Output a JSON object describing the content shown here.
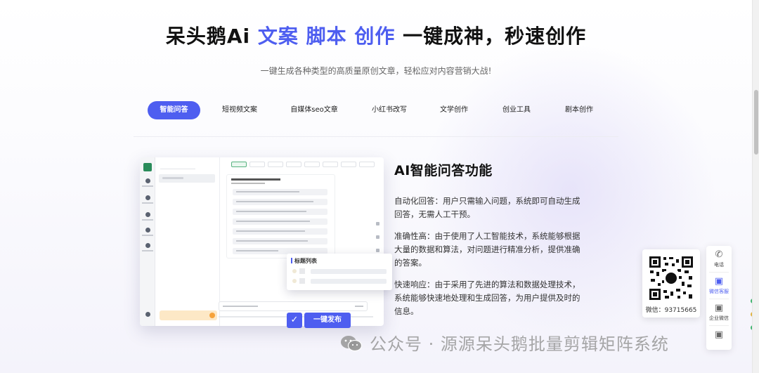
{
  "hero": {
    "title_plain_1": "呆头鹅Ai ",
    "title_accent": "文案 脚本 创作",
    "title_plain_2": " 一键成神，秒速创作",
    "subtitle": "一键生成各种类型的高质量原创文章，轻松应对内容营销大战!"
  },
  "tabs": [
    {
      "label": "智能问答",
      "active": true
    },
    {
      "label": "短视频文案",
      "active": false
    },
    {
      "label": "自媒体seo文章",
      "active": false
    },
    {
      "label": "小红书改写",
      "active": false
    },
    {
      "label": "文学创作",
      "active": false
    },
    {
      "label": "创业工具",
      "active": false
    },
    {
      "label": "剧本创作",
      "active": false
    }
  ],
  "popup": {
    "title": "标题列表"
  },
  "publish": {
    "check_icon": "✓",
    "label": "一键发布"
  },
  "feature": {
    "title": "AI智能问答功能",
    "paragraphs": [
      "自动化回答：用户只需输入问题，系统即可自动生成回答，无需人工干预。",
      "准确性高：由于使用了人工智能技术，系统能够根据大量的数据和算法，对问题进行精准分析，提供准确的答案。",
      "快速响应：由于采用了先进的算法和数据处理技术，系统能够快速地处理和生成回答，为用户提供及时的信息。"
    ]
  },
  "contact": {
    "wechat_label": "微信：93715665",
    "side_items": [
      {
        "label": "电话",
        "icon": "phone-icon",
        "glyph": "✆",
        "active": false
      },
      {
        "label": "微信客服",
        "icon": "qr-icon",
        "glyph": "▣",
        "active": true
      },
      {
        "label": "企业微信",
        "icon": "qr-icon",
        "glyph": "▣",
        "active": false
      },
      {
        "label": "",
        "icon": "qr-icon",
        "glyph": "▣",
        "active": false
      }
    ]
  },
  "watermark": {
    "text": "公众号 · 源源呆头鹅批量剪辑矩阵系统"
  },
  "colors": {
    "accent": "#4e5ef0",
    "app_green": "#2a8c5a"
  }
}
